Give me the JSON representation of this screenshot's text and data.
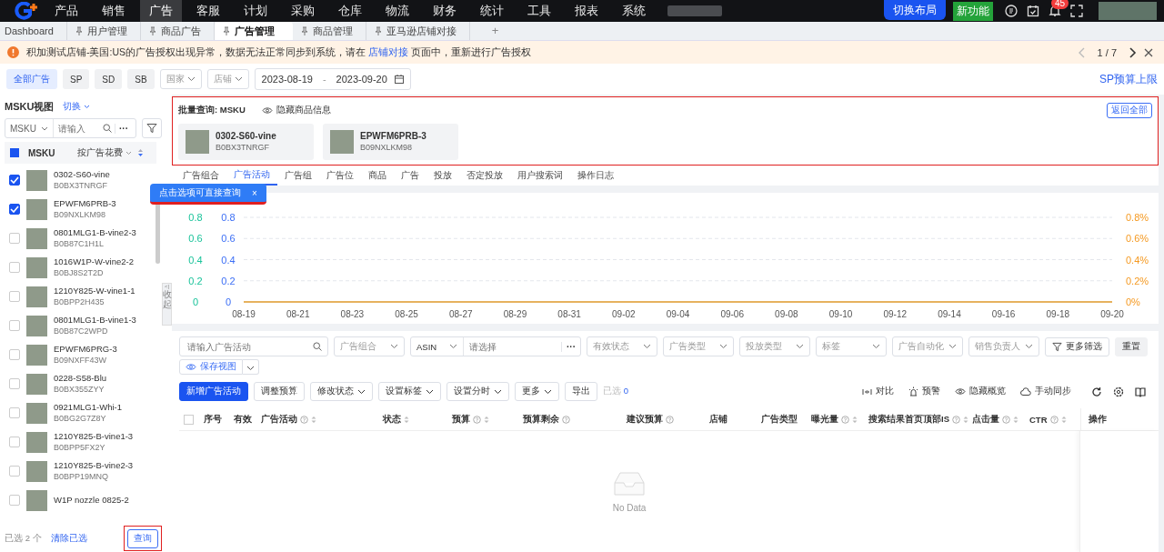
{
  "top_nav": {
    "items": [
      {
        "label": "产品",
        "selected": false
      },
      {
        "label": "销售",
        "selected": false
      },
      {
        "label": "广告",
        "selected": true
      },
      {
        "label": "客服",
        "selected": false
      },
      {
        "label": "计划",
        "selected": false
      },
      {
        "label": "采购",
        "selected": false
      },
      {
        "label": "仓库",
        "selected": false
      },
      {
        "label": "物流",
        "selected": false
      },
      {
        "label": "财务",
        "selected": false
      },
      {
        "label": "统计",
        "selected": false
      },
      {
        "label": "工具",
        "selected": false
      },
      {
        "label": "报表",
        "selected": false
      },
      {
        "label": "系统",
        "selected": false
      }
    ],
    "layout_button": "切换布局",
    "new_feature": "新功能",
    "notification_count": "45"
  },
  "page_tabs": {
    "items": [
      {
        "label": "Dashboard",
        "pinned": false,
        "selected": false
      },
      {
        "label": "用户管理",
        "pinned": true,
        "selected": false
      },
      {
        "label": "商品广告",
        "pinned": true,
        "selected": false
      },
      {
        "label": "广告管理",
        "pinned": true,
        "selected": true
      },
      {
        "label": "商品管理",
        "pinned": true,
        "selected": false
      },
      {
        "label": "亚马逊店铺对接",
        "pinned": true,
        "selected": false
      }
    ],
    "add": "+"
  },
  "alert": {
    "text_before": "积加测试店铺-美国:US的广告授权出现异常，数据无法正常同步到系统，请在 ",
    "link": "店铺对接",
    "text_after": " 页面中，重新进行广告授权",
    "pager": "1 / 7"
  },
  "ad_type_filters": [
    {
      "label": "全部广告",
      "selected": true
    },
    {
      "label": "SP",
      "selected": false
    },
    {
      "label": "SD",
      "selected": false
    },
    {
      "label": "SB",
      "selected": false
    }
  ],
  "country_select": {
    "placeholder": "国家"
  },
  "shop_select": {
    "placeholder": "店铺"
  },
  "date_range": {
    "start": "2023-08-19",
    "separator": "-",
    "end": "2023-09-20"
  },
  "budget_link": "SP预算上限",
  "sidebar": {
    "title": "MSKU视图",
    "switch": "切换",
    "field_select": "MSKU",
    "search": {
      "placeholder": "请输入"
    },
    "more": "···",
    "header_checkbox_partial": true,
    "header_label": "MSKU",
    "sort_label": "按广告花费",
    "items": [
      {
        "msku": "0302-S60-vine",
        "asin": "B0BX3TNRGF",
        "checked": true
      },
      {
        "msku": "EPWFM6PRB-3",
        "asin": "B09NXLKM98",
        "checked": true
      },
      {
        "msku": "0801MLG1-B-vine2-3",
        "asin": "B0B87C1H1L",
        "checked": false
      },
      {
        "msku": "1016W1P-W-vine2-2",
        "asin": "B0BJ8S2T2D",
        "checked": false
      },
      {
        "msku": "1210Y825-W-vine1-1",
        "asin": "B0BPP2H435",
        "checked": false
      },
      {
        "msku": "0801MLG1-B-vine1-3",
        "asin": "B0B87C2WPD",
        "checked": false
      },
      {
        "msku": "EPWFM6PRG-3",
        "asin": "B09NXFF43W",
        "checked": false
      },
      {
        "msku": "0228-S58-Blu",
        "asin": "B0BX355ZYY",
        "checked": false
      },
      {
        "msku": "0921MLG1-Whi-1",
        "asin": "B0BG2G7Z8Y",
        "checked": false
      },
      {
        "msku": "1210Y825-B-vine1-3",
        "asin": "B0BPP5FX2Y",
        "checked": false
      },
      {
        "msku": "1210Y825-B-vine2-3",
        "asin": "B0BPP19MNQ",
        "checked": false
      },
      {
        "msku": "W1P nozzle 0825-2",
        "checked": false
      }
    ],
    "selected_count": "已选 2 个",
    "clear": "清除已选",
    "query": "查询"
  },
  "tooltip": {
    "text": "点击选项可直接查询",
    "close": "×"
  },
  "collapse_handle": {
    "arrow": "<|",
    "label": "收起"
  },
  "batch_query": {
    "title": "批量查询: MSKU",
    "hide_info": "隐藏商品信息",
    "back_all": "返回全部",
    "products": [
      {
        "msku": "0302-S60-vine",
        "asin": "B0BX3TNRGF"
      },
      {
        "msku": "EPWFM6PRB-3",
        "asin": "B09NXLKM98"
      }
    ]
  },
  "view_tabs": [
    {
      "label": "广告组合",
      "selected": false
    },
    {
      "label": "广告活动",
      "selected": true
    },
    {
      "label": "广告组",
      "selected": false
    },
    {
      "label": "广告位",
      "selected": false
    },
    {
      "label": "商品",
      "selected": false
    },
    {
      "label": "广告",
      "selected": false
    },
    {
      "label": "投放",
      "selected": false
    },
    {
      "label": "否定投放",
      "selected": false
    },
    {
      "label": "用户搜索词",
      "selected": false
    },
    {
      "label": "操作日志",
      "selected": false
    }
  ],
  "chart": {
    "left_axes": [
      {
        "color": "#19c39a",
        "labels": [
          "0.8",
          "0.6",
          "0.4",
          "0.2",
          "0"
        ]
      },
      {
        "color": "#3b6ef5",
        "labels": [
          "0.8",
          "0.6",
          "0.4",
          "0.2",
          "0"
        ]
      }
    ],
    "right_axis": {
      "color": "#f59a23",
      "labels": [
        "0.8%",
        "0.6%",
        "0.4%",
        "0.2%",
        "0%"
      ]
    },
    "chart_data": {
      "type": "line",
      "grid": true,
      "categories": [
        "08-19",
        "08-21",
        "08-23",
        "08-25",
        "08-27",
        "08-29",
        "08-31",
        "09-02",
        "09-04",
        "09-06",
        "09-08",
        "09-10",
        "09-12",
        "09-14",
        "09-16",
        "09-18",
        "09-20"
      ],
      "ylim": [
        0,
        0.8
      ],
      "yticks": [
        0,
        0.2,
        0.4,
        0.6,
        0.8
      ],
      "series": [
        {
          "color": "#e6a030",
          "values": [
            0,
            0,
            0,
            0,
            0,
            0,
            0,
            0,
            0,
            0,
            0,
            0,
            0,
            0,
            0,
            0,
            0
          ]
        }
      ]
    }
  },
  "filters": [
    {
      "kind": "search",
      "placeholder": "请输入广告活动"
    },
    {
      "kind": "select",
      "placeholder": "广告组合"
    },
    {
      "kind": "combo",
      "value": "ASIN",
      "placeholder": "请选择",
      "more": "···"
    },
    {
      "kind": "select",
      "placeholder": "有效状态"
    },
    {
      "kind": "select",
      "placeholder": "广告类型"
    },
    {
      "kind": "select",
      "placeholder": "投放类型"
    },
    {
      "kind": "select",
      "placeholder": "标签"
    },
    {
      "kind": "select",
      "placeholder": "广告自动化"
    },
    {
      "kind": "select",
      "placeholder": "销售负责人"
    },
    {
      "kind": "filter-button",
      "label": "更多筛选"
    },
    {
      "kind": "button",
      "label": "重置"
    }
  ],
  "save_view": "保存视图",
  "actions": [
    {
      "label": "新增广告活动",
      "kind": "primary"
    },
    {
      "label": "调整预算",
      "kind": "plain"
    },
    {
      "label": "修改状态",
      "kind": "dropdown"
    },
    {
      "label": "设置标签",
      "kind": "dropdown"
    },
    {
      "label": "设置分时",
      "kind": "dropdown"
    },
    {
      "label": "更多",
      "kind": "dropdown"
    },
    {
      "label": "导出",
      "kind": "plain"
    }
  ],
  "selected_label": "已选",
  "selected_count": "0",
  "tools": [
    {
      "label": "对比",
      "kind": "compare"
    },
    {
      "label": "预警",
      "kind": "alarm"
    },
    {
      "label": "隐藏概览",
      "kind": "eye"
    },
    {
      "label": "手动同步",
      "kind": "cloud"
    }
  ],
  "table": {
    "select_all_checked": false,
    "columns": [
      {
        "label": "序号",
        "help": false,
        "sort": false
      },
      {
        "label": "有效",
        "help": false,
        "sort": false
      },
      {
        "label": "广告活动",
        "help": true,
        "sort": true
      },
      {
        "label": "状态",
        "help": false,
        "sort": true
      },
      {
        "label": "预算",
        "help": true,
        "sort": true
      },
      {
        "label": "预算剩余",
        "help": true,
        "sort": false
      },
      {
        "label": "建议预算",
        "help": true,
        "sort": false
      },
      {
        "label": "店铺",
        "help": false,
        "sort": false
      },
      {
        "label": "广告类型",
        "help": false,
        "sort": false
      },
      {
        "label": "曝光量",
        "help": true,
        "sort": true
      },
      {
        "label": "搜索结果首页顶部IS",
        "help": true,
        "sort": true
      },
      {
        "label": "点击量",
        "help": true,
        "sort": true
      },
      {
        "label": "CTR",
        "help": true,
        "sort": true
      }
    ],
    "action_column": "操作",
    "empty": "No Data"
  }
}
